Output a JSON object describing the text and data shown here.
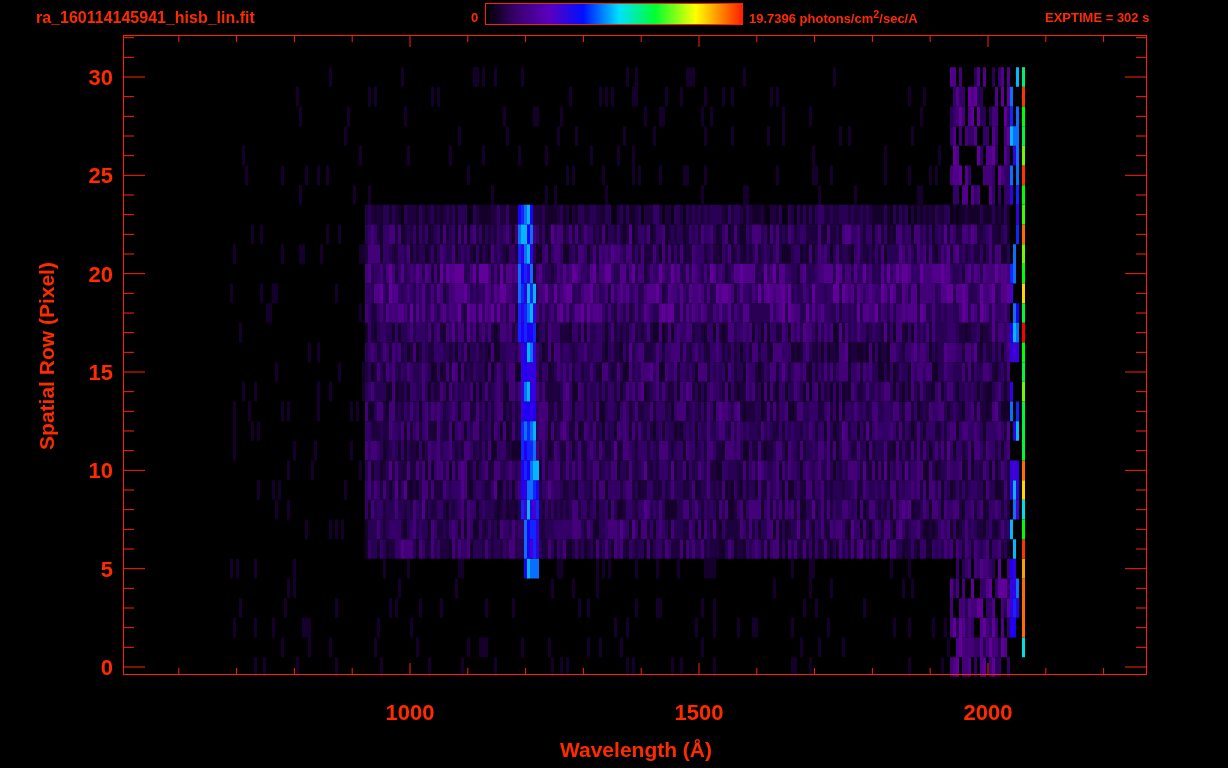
{
  "header": {
    "filename": "ra_160114145941_hisb_lin.fit",
    "colorbar": {
      "min_label": "0",
      "max_label": "19.7396 photons/cm$^{2}$/sec/A"
    },
    "exptime": "EXPTIME = 302 s"
  },
  "plot": {
    "xlabel": "Wavelength (Å)",
    "ylabel": "Spatial Row (Pixel)",
    "xticks": [
      "1000",
      "1500",
      "2000"
    ],
    "yticks": [
      "30",
      "25",
      "20",
      "15",
      "10",
      "5",
      "0"
    ]
  }
}
